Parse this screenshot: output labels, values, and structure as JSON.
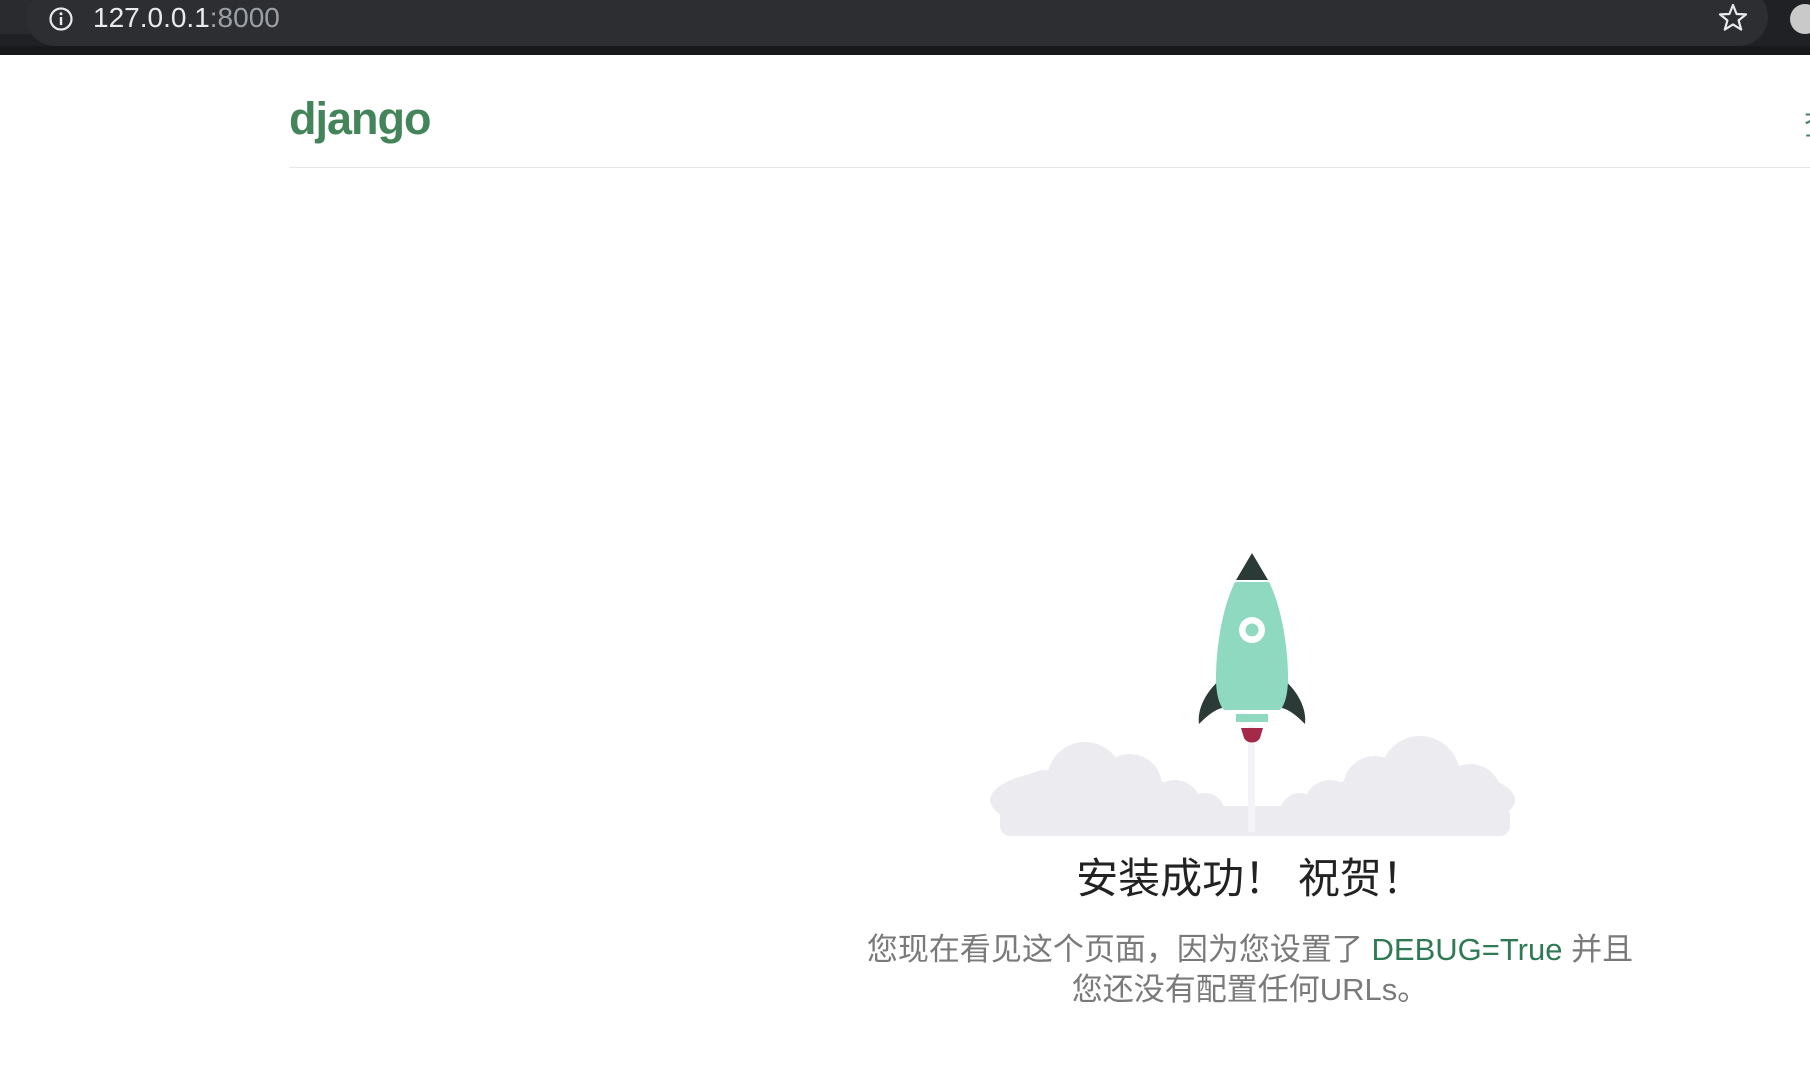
{
  "browser": {
    "url_host": "127.0.0.1",
    "url_port": ":8000",
    "icons": {
      "site_info": "info-icon",
      "bookmark": "star-icon",
      "profile": "avatar"
    },
    "colors": {
      "bar_bg": "#202124",
      "pill_bg": "#2d2e31"
    }
  },
  "header": {
    "logo_text": "django",
    "right_text": "查",
    "logo_color": "#44845a"
  },
  "main": {
    "illustration": "rocket-launch",
    "headline": "安装成功！ 祝贺！",
    "desc_before": "您现在看见这个页面，因为您设置了 ",
    "desc_highlight": "DEBUG=True",
    "desc_after": " 并且",
    "desc_line2": "您还没有配置任何URLs。",
    "colors": {
      "rocket_body": "#8ed9bf",
      "rocket_dark": "#2b3a37",
      "flame": "#a52a4a",
      "cloud": "#ececf0",
      "highlight": "#2f7a55"
    }
  }
}
